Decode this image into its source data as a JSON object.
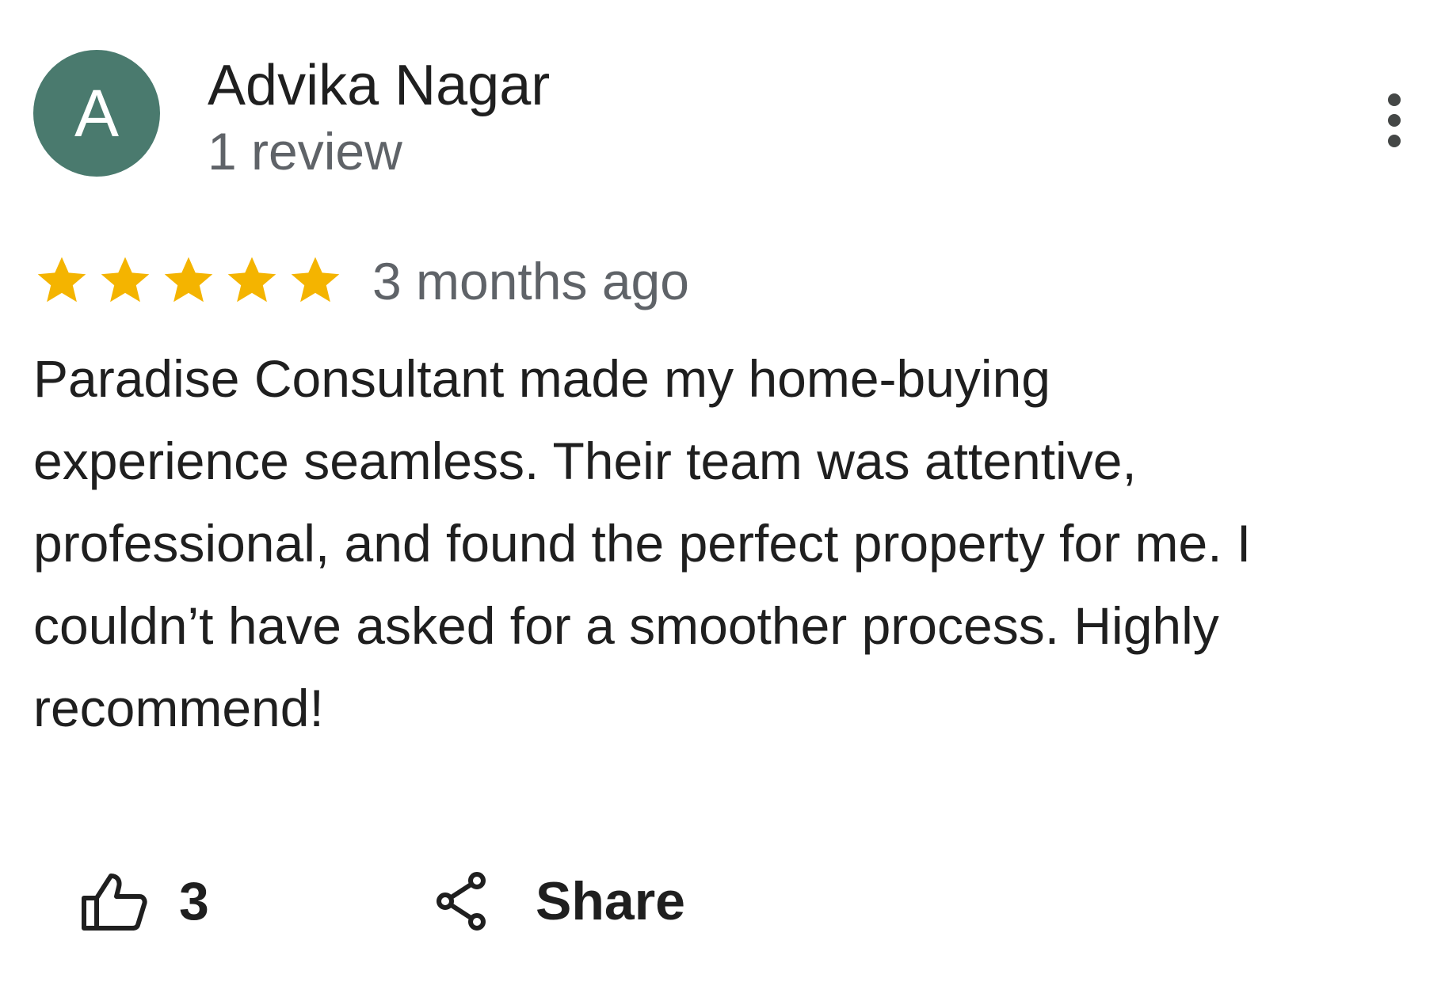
{
  "review": {
    "author": {
      "initial": "A",
      "name": "Advika Nagar",
      "review_count": "1 review",
      "avatar_color": "#4a7a6e"
    },
    "rating": 5,
    "star_color": "#f4b400",
    "time": "3 months ago",
    "text_lines": [
      "Paradise Consultant made my home-buying",
      "experience seamless. Their team was attentive,",
      "professional, and found the perfect property for me. I",
      "couldn’t have asked for a smoother process. Highly",
      "recommend!"
    ],
    "actions": {
      "like_icon": "thumb-up-icon",
      "like_count": "3",
      "share_icon": "share-icon",
      "share_label": "Share",
      "more_icon": "more-vert-icon"
    }
  }
}
